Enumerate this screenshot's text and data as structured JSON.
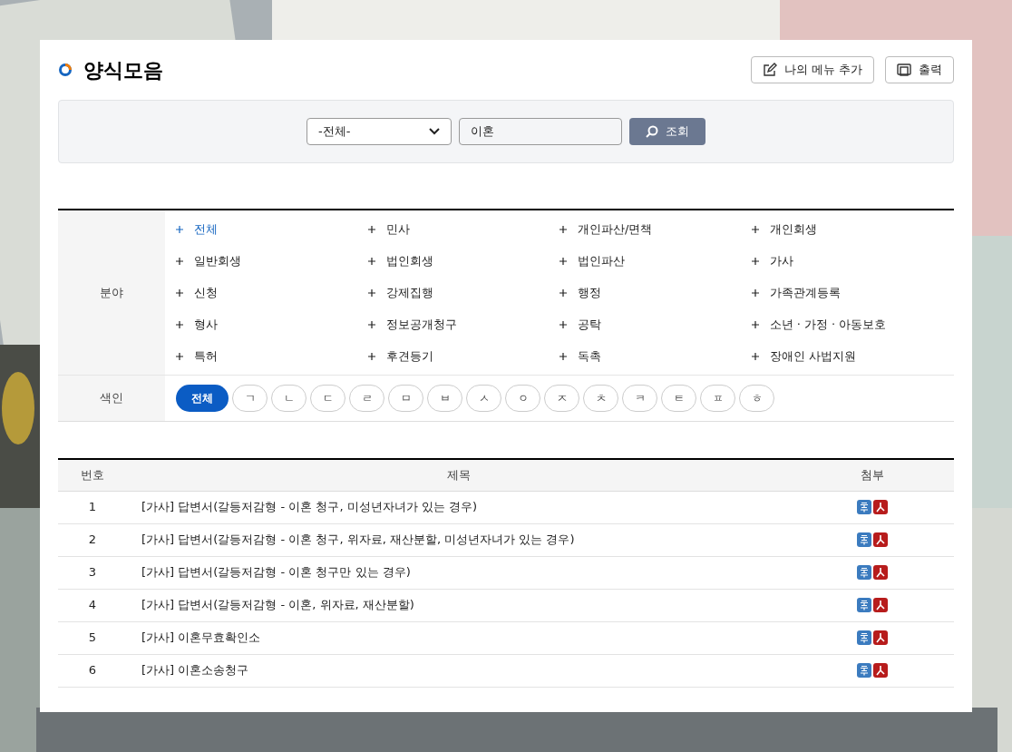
{
  "page": {
    "title": "양식모음"
  },
  "header_buttons": [
    {
      "kind": "edit",
      "label": "나의 메뉴 추가"
    },
    {
      "kind": "print",
      "label": "출력"
    }
  ],
  "search": {
    "select_value": "-전체-",
    "query": "이혼",
    "button": "조회"
  },
  "fields": {
    "label": "분야",
    "items": [
      {
        "label": "전체",
        "selected": true
      },
      {
        "label": "민사",
        "selected": false
      },
      {
        "label": "개인파산/면책",
        "selected": false
      },
      {
        "label": "개인회생",
        "selected": false
      },
      {
        "label": "일반회생",
        "selected": false
      },
      {
        "label": "법인회생",
        "selected": false
      },
      {
        "label": "법인파산",
        "selected": false
      },
      {
        "label": "가사",
        "selected": false
      },
      {
        "label": "신청",
        "selected": false
      },
      {
        "label": "강제집행",
        "selected": false
      },
      {
        "label": "행정",
        "selected": false
      },
      {
        "label": "가족관계등록",
        "selected": false
      },
      {
        "label": "형사",
        "selected": false
      },
      {
        "label": "정보공개청구",
        "selected": false
      },
      {
        "label": "공탁",
        "selected": false
      },
      {
        "label": "소년 · 가정 · 아동보호",
        "selected": false
      },
      {
        "label": "특허",
        "selected": false
      },
      {
        "label": "후견등기",
        "selected": false
      },
      {
        "label": "독촉",
        "selected": false
      },
      {
        "label": "장애인 사법지원",
        "selected": false
      }
    ]
  },
  "index": {
    "label": "색인",
    "items": [
      {
        "label": "전체",
        "selected": true
      },
      {
        "label": "ㄱ",
        "selected": false
      },
      {
        "label": "ㄴ",
        "selected": false
      },
      {
        "label": "ㄷ",
        "selected": false
      },
      {
        "label": "ㄹ",
        "selected": false
      },
      {
        "label": "ㅁ",
        "selected": false
      },
      {
        "label": "ㅂ",
        "selected": false
      },
      {
        "label": "ㅅ",
        "selected": false
      },
      {
        "label": "ㅇ",
        "selected": false
      },
      {
        "label": "ㅈ",
        "selected": false
      },
      {
        "label": "ㅊ",
        "selected": false
      },
      {
        "label": "ㅋ",
        "selected": false
      },
      {
        "label": "ㅌ",
        "selected": false
      },
      {
        "label": "ㅍ",
        "selected": false
      },
      {
        "label": "ㅎ",
        "selected": false
      }
    ]
  },
  "table": {
    "columns": [
      "번호",
      "제목",
      "첨부"
    ],
    "rows": [
      {
        "number": "1",
        "title": "[가사] 답변서(갈등저감형 - 이혼 청구, 미성년자녀가 있는 경우)",
        "attachments": [
          {
            "kind": "hwp"
          },
          {
            "kind": "pdf"
          }
        ]
      },
      {
        "number": "2",
        "title": "[가사] 답변서(갈등저감형 - 이혼 청구, 위자료, 재산분할, 미성년자녀가 있는 경우)",
        "attachments": [
          {
            "kind": "hwp"
          },
          {
            "kind": "pdf"
          }
        ]
      },
      {
        "number": "3",
        "title": "[가사] 답변서(갈등저감형 - 이혼 청구만 있는 경우)",
        "attachments": [
          {
            "kind": "hwp"
          },
          {
            "kind": "pdf"
          }
        ]
      },
      {
        "number": "4",
        "title": "[가사] 답변서(갈등저감형 - 이혼, 위자료, 재산분할)",
        "attachments": [
          {
            "kind": "hwp"
          },
          {
            "kind": "pdf"
          }
        ]
      },
      {
        "number": "5",
        "title": "[가사] 이혼무효확인소",
        "attachments": [
          {
            "kind": "hwp"
          },
          {
            "kind": "pdf"
          }
        ]
      },
      {
        "number": "6",
        "title": "[가사] 이혼소송청구",
        "attachments": [
          {
            "kind": "hwp"
          },
          {
            "kind": "pdf"
          }
        ]
      }
    ]
  }
}
